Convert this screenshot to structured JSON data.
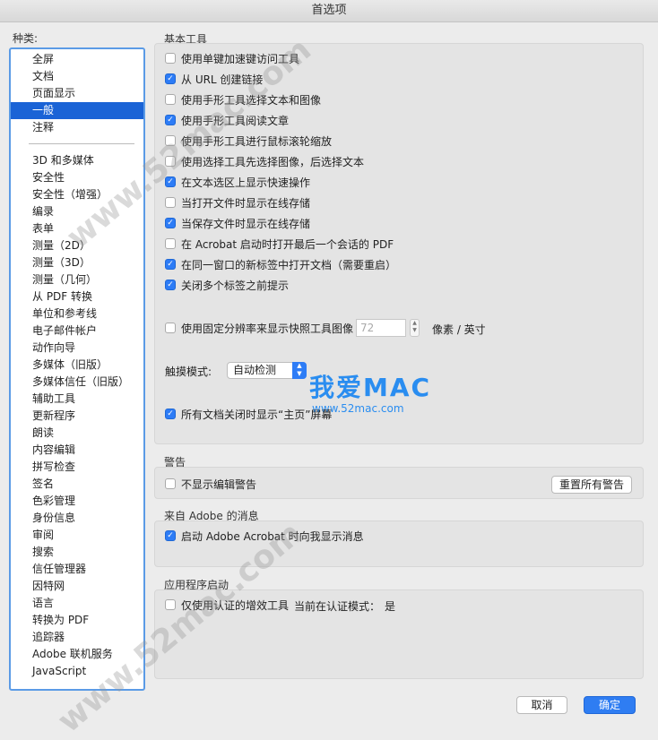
{
  "window": {
    "title": "首选项"
  },
  "sidebar": {
    "label": "种类:",
    "items": [
      "全屏",
      "文档",
      "页面显示",
      "一般",
      "注释",
      "3D 和多媒体",
      "安全性",
      "安全性（增强）",
      "编录",
      "表单",
      "测量（2D）",
      "测量（3D）",
      "测量（几何）",
      "从 PDF 转换",
      "单位和参考线",
      "电子邮件帐户",
      "动作向导",
      "多媒体（旧版）",
      "多媒体信任（旧版）",
      "辅助工具",
      "更新程序",
      "朗读",
      "内容编辑",
      "拼写检查",
      "签名",
      "色彩管理",
      "身份信息",
      "审阅",
      "搜索",
      "信任管理器",
      "因特网",
      "语言",
      "转换为 PDF",
      "追踪器",
      "Adobe 联机服务",
      "JavaScript"
    ],
    "selected": "一般"
  },
  "basic_tools": {
    "title": "基本工具",
    "options": [
      {
        "label": "使用单键加速键访问工具",
        "checked": false
      },
      {
        "label": "从 URL 创建链接",
        "checked": true
      },
      {
        "label": "使用手形工具选择文本和图像",
        "checked": false
      },
      {
        "label": "使用手形工具阅读文章",
        "checked": true
      },
      {
        "label": "使用手形工具进行鼠标滚轮缩放",
        "checked": false
      },
      {
        "label": "使用选择工具先选择图像，后选择文本",
        "checked": false
      },
      {
        "label": "在文本选区上显示快速操作",
        "checked": true
      },
      {
        "label": "当打开文件时显示在线存储",
        "checked": false
      },
      {
        "label": "当保存文件时显示在线存储",
        "checked": true
      },
      {
        "label": "在 Acrobat 启动时打开最后一个会话的 PDF",
        "checked": false
      },
      {
        "label": "在同一窗口的新标签中打开文档（需要重启）",
        "checked": true
      },
      {
        "label": "关闭多个标签之前提示",
        "checked": true
      }
    ],
    "fixed_resolution": {
      "label": "使用固定分辨率来显示快照工具图像",
      "checked": false,
      "value": "72",
      "unit": "像素 / 英寸"
    },
    "touch_mode": {
      "label": "触摸模式:",
      "value": "自动检测"
    },
    "home_screen": {
      "label": "所有文档关闭时显示“主页”屏幕",
      "checked": true
    }
  },
  "warnings": {
    "title": "警告",
    "option": {
      "label": "不显示编辑警告",
      "checked": false
    },
    "reset_button": "重置所有警告"
  },
  "adobe_messages": {
    "title": "来自 Adobe 的消息",
    "option": {
      "label": "启动 Adobe Acrobat 时向我显示消息",
      "checked": true
    }
  },
  "app_startup": {
    "title": "应用程序启动",
    "option": {
      "label": "仅使用认证的增效工具",
      "checked": false
    },
    "status_label": "当前在认证模式：",
    "status_value": "是"
  },
  "footer": {
    "cancel": "取消",
    "ok": "确定"
  },
  "watermark": {
    "brand": "我爱MAC",
    "url": "www.52mac.com",
    "diagonal": "www.52mac.com"
  },
  "colors": {
    "accent": "#2d7cf6",
    "selection": "#1a63d6"
  }
}
